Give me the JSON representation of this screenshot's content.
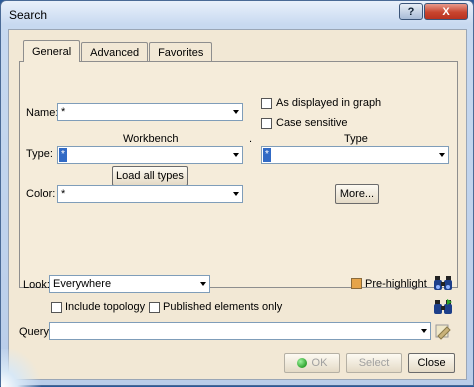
{
  "window": {
    "title": "Search",
    "help_label": "?",
    "close_label": "X"
  },
  "tabs": [
    {
      "label": "General",
      "active": true
    },
    {
      "label": "Advanced",
      "active": false
    },
    {
      "label": "Favorites",
      "active": false
    }
  ],
  "general": {
    "name_label": "Name:",
    "name_value": "*",
    "workbench_header": "Workbench",
    "separator_dot": ".",
    "type_header": "Type",
    "type_label": "Type:",
    "workbench_value": "*",
    "type_value": "*",
    "load_all_types_label": "Load all types",
    "color_label": "Color:",
    "color_value": "*",
    "as_displayed_label": "As displayed in graph",
    "as_displayed_checked": false,
    "case_sensitive_label": "Case sensitive",
    "case_sensitive_checked": false,
    "more_label": "More..."
  },
  "bottom": {
    "look_label": "Look:",
    "look_value": "Everywhere",
    "pre_highlight_label": "Pre-highlight",
    "pre_highlight_checked": true,
    "include_topology_label": "Include topology",
    "include_topology_checked": false,
    "published_only_label": "Published elements only",
    "published_only_checked": false,
    "query_label": "Query:",
    "query_value": ""
  },
  "actions": {
    "ok_label": "OK",
    "select_label": "Select",
    "close_label": "Close"
  },
  "icons": {
    "search": "binoculars-icon",
    "search_forward": "binoculars-forward-icon",
    "clear_query": "eraser-icon"
  },
  "colors": {
    "accent": "#316ac5",
    "dialog_bg": "#f2e8d5",
    "checked": "#e5a44a"
  }
}
